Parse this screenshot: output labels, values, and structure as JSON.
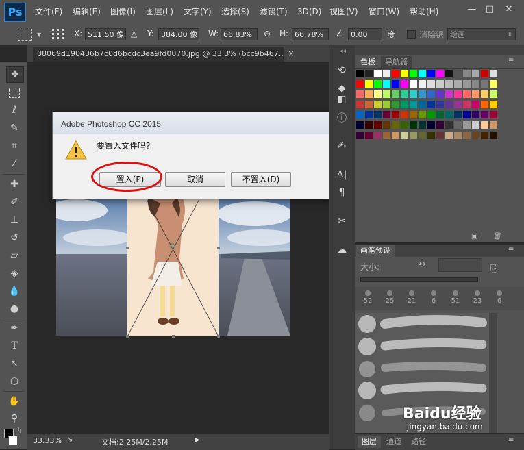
{
  "app": {
    "logo": "Ps"
  },
  "menu": [
    "文件(F)",
    "编辑(E)",
    "图像(I)",
    "图层(L)",
    "文字(Y)",
    "选择(S)",
    "滤镜(T)",
    "3D(D)",
    "视图(V)",
    "窗口(W)",
    "帮助(H)"
  ],
  "window_controls": {
    "minimize": "—",
    "restore": "□",
    "close": "✕"
  },
  "options": {
    "x_label": "X:",
    "x_value": "511.50 像",
    "y_label": "Y:",
    "y_value": "384.00 像",
    "w_label": "W:",
    "w_value": "66.83%",
    "h_label": "H:",
    "h_value": "66.78%",
    "angle_value": "0.00",
    "angle_unit": "度",
    "antialias_label": "消除锯",
    "interp_value": "绘画"
  },
  "document": {
    "tab_title": "08069d190436b7c0d6bcdc3ea9fd0070.jpg @ 33.3% (6cc9b467...",
    "tab_close": "×"
  },
  "dialog": {
    "title": "Adobe Photoshop CC 2015",
    "message": "要置入文件吗?",
    "place_button": "置入(P)",
    "cancel_button": "取消",
    "dont_place_button": "不置入(D)"
  },
  "swatches_panel": {
    "tab_swatches": "色板",
    "tab_navigator": "导航器"
  },
  "brush_panel": {
    "title": "画笔预设",
    "size_label": "大小:",
    "brush_sizes": [
      "52",
      "25",
      "21",
      "6",
      "51",
      "23",
      "6"
    ]
  },
  "bottom_tabs": {
    "layers": "图层",
    "channels": "通道",
    "paths": "路径"
  },
  "status": {
    "zoom": "33.33%",
    "doc_info": "文档:2.25M/2.25M"
  },
  "watermark": {
    "brand": "Baidu经验",
    "url": "jingyan.baidu.com"
  },
  "colors": {
    "dialog_highlight": "#e01010",
    "ui_panel": "#535353",
    "canvas_bg": "#282828"
  }
}
